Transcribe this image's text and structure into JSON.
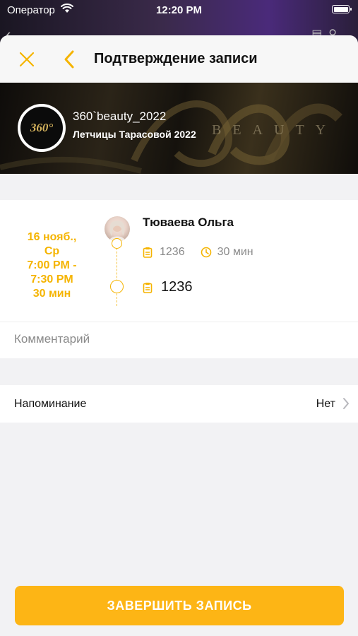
{
  "status_bar": {
    "carrier": "Оператор",
    "time": "12:20 PM"
  },
  "nav": {
    "title": "Подтверждение записи"
  },
  "salon": {
    "name": "360`beauty_2022",
    "address": "Летчицы Тарасовой 2022",
    "logo_text": "360°"
  },
  "appointment": {
    "date": "16 нояб.,",
    "weekday": "Ср",
    "time_start": "7:00 PM -",
    "time_end": "7:30 PM",
    "duration": "30 мин",
    "master_name": "Тюваева Ольга",
    "service_code": "1236",
    "service_duration": "30 мин",
    "service_name": "1236"
  },
  "comment": {
    "placeholder": "Комментарий",
    "value": ""
  },
  "reminder": {
    "label": "Напоминание",
    "value": "Нет"
  },
  "finish_button": {
    "label": "ЗАВЕРШИТЬ ЗАПИСЬ"
  },
  "colors": {
    "accent": "#fdb515",
    "accent_text": "#f5b400"
  },
  "icons": {
    "close": "close-icon",
    "back": "chevron-left-icon",
    "service": "clipboard-icon",
    "duration": "clock-icon",
    "reminder_chevron": "chevron-right-icon"
  }
}
